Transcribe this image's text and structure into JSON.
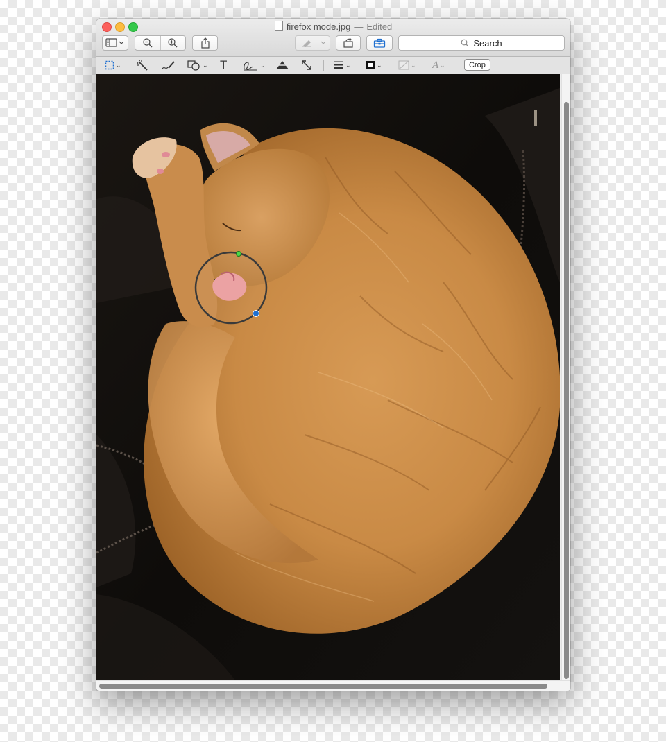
{
  "window": {
    "filename": "firefox mode.jpg",
    "separator": "—",
    "status": "Edited"
  },
  "toolbar": {
    "search_label": "Search",
    "icons": [
      "sidebar-icon",
      "zoom-out-icon",
      "zoom-in-icon",
      "share-icon",
      "highlight-icon",
      "rotate-icon",
      "toolbox-icon"
    ]
  },
  "markup": {
    "crop_label": "Crop",
    "tools": [
      "rect-select-icon",
      "instant-alpha-icon",
      "sketch-icon",
      "shapes-icon",
      "text-icon",
      "sign-icon",
      "adjust-color-icon",
      "adjust-size-icon",
      "shape-style-icon",
      "border-color-icon",
      "fill-color-icon",
      "text-style-icon"
    ]
  },
  "image": {
    "subject": "orange cat curled up",
    "loupe": true
  },
  "colors": {
    "close": "#fc605c",
    "minimize": "#fdbc40",
    "zoom": "#34c84a",
    "accent": "#1e6fd0"
  }
}
